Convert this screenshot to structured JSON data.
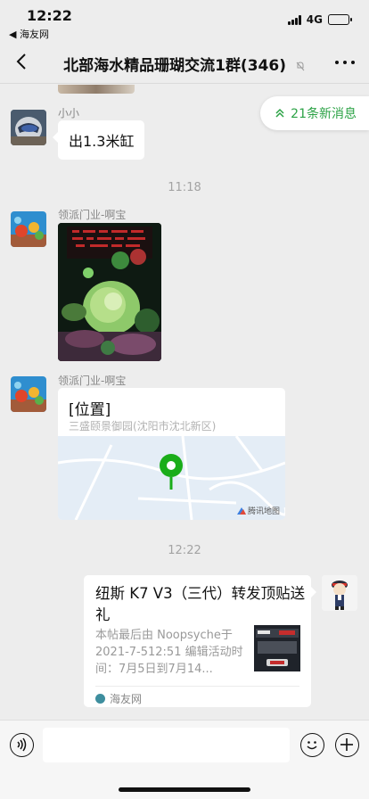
{
  "status": {
    "time": "12:22",
    "back_label": "◀ 海友网",
    "network": "4G",
    "battery_level": 0.4
  },
  "nav": {
    "title": "北部海水精品珊瑚交流1群(346)"
  },
  "new_messages": "21条新消息",
  "messages": [
    {
      "sender": "小小",
      "text": "出1.3米缸"
    },
    {
      "timestamp": "11:18"
    },
    {
      "sender": "领派门业-啊宝",
      "type": "image"
    },
    {
      "sender": "领派门业-啊宝",
      "type": "location",
      "title": "[位置]",
      "address": "三盛颐景御园(沈阳市沈北新区)",
      "map_brand": "腾讯地图"
    },
    {
      "timestamp": "12:22"
    },
    {
      "type": "link",
      "title": "纽斯 K7 V3（三代）转发顶贴送礼",
      "desc": "本帖最后由 Noopsyche于 2021-7-512:51 编辑活动时间：7月5日到7月14...",
      "source": "海友网"
    }
  ],
  "colors": {
    "accent": "#2ba245",
    "background": "#ededed",
    "map_pin": "#1aad19"
  },
  "icons": [
    "back-arrow-icon",
    "mute-bell-icon",
    "more-icon",
    "double-chevron-up-icon",
    "map-pin-icon",
    "voice-icon",
    "emoji-icon",
    "plus-icon"
  ]
}
